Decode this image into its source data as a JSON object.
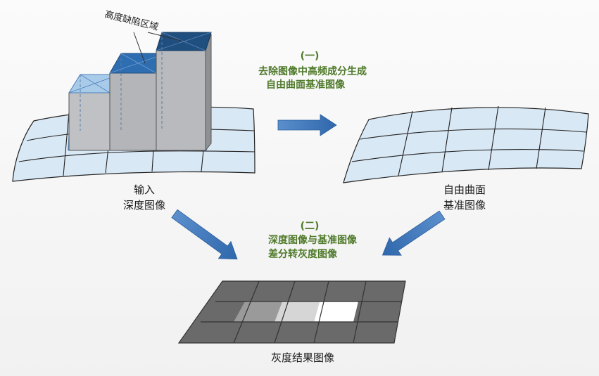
{
  "annotation": {
    "height_defect_region": "高度缺陷区域"
  },
  "step1": {
    "index": "(一)",
    "line1": "去除图像中高频成分生成",
    "line2": "自由曲面基准图像"
  },
  "step2": {
    "index": "(二)",
    "line1": "深度图像与基准图像",
    "line2": "差分转灰度图像"
  },
  "input_image": {
    "line1": "输入",
    "line2": "深度图像"
  },
  "reference_image": {
    "line1": "自由曲面",
    "line2": "基准图像"
  },
  "result_image": {
    "label": "灰度结果图像"
  },
  "colors": {
    "surface_fill": "#d9e8f5",
    "surface_line": "#222222",
    "defect_blue_dark": "#1f4f7f",
    "defect_blue_mid": "#2e6db0",
    "defect_blue_light": "#a9cbea",
    "arrow": "#3d78bd",
    "step_text": "#4f7a2a",
    "gray_dark": "#6a6a6a",
    "gray_mid": "#9a9a9a",
    "gray_light": "#d6d6d6",
    "white": "#ffffff"
  }
}
